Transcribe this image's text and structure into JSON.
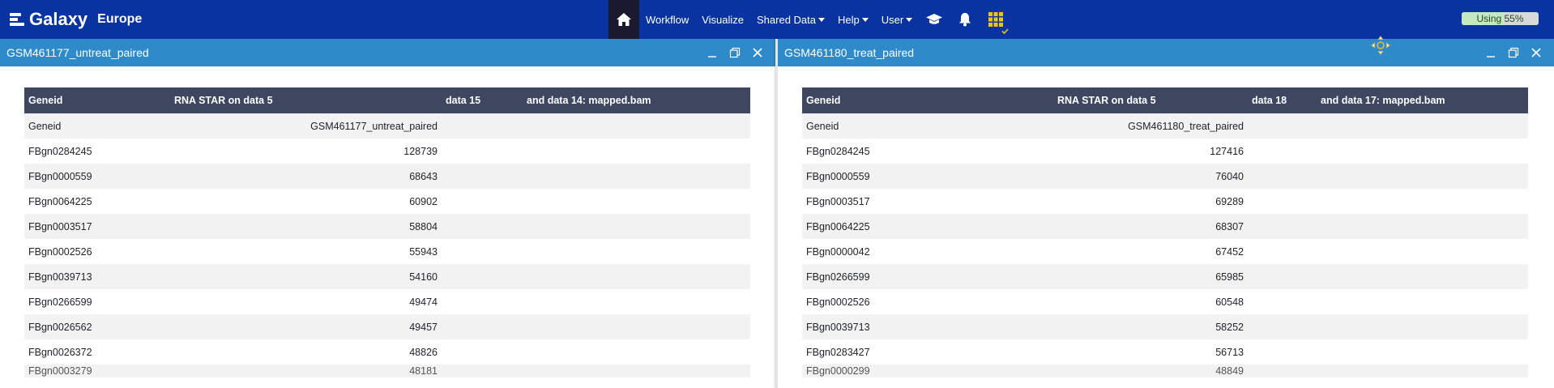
{
  "brand": {
    "name": "Galaxy",
    "subtitle": "Europe"
  },
  "nav": {
    "workflow": "Workflow",
    "visualize": "Visualize",
    "shared_data": "Shared Data",
    "help": "Help",
    "user": "User"
  },
  "quota": {
    "label": "Using 55%",
    "percent": 55
  },
  "left_window": {
    "title": "GSM461177_untreat_paired",
    "headers": [
      "Geneid",
      "RNA STAR on data 5",
      "data 15",
      "and data 14: mapped.bam"
    ],
    "rows": [
      [
        "Geneid",
        "GSM461177_untreat_paired"
      ],
      [
        "FBgn0284245",
        "128739"
      ],
      [
        "FBgn0000559",
        "68643"
      ],
      [
        "FBgn0064225",
        "60902"
      ],
      [
        "FBgn0003517",
        "58804"
      ],
      [
        "FBgn0002526",
        "55943"
      ],
      [
        "FBgn0039713",
        "54160"
      ],
      [
        "FBgn0266599",
        "49474"
      ],
      [
        "FBgn0026562",
        "49457"
      ],
      [
        "FBgn0026372",
        "48826"
      ],
      [
        "FBgn0003279",
        "48181"
      ]
    ]
  },
  "right_window": {
    "title": "GSM461180_treat_paired",
    "headers": [
      "Geneid",
      "RNA STAR on data 5",
      "data 18",
      "and data 17: mapped.bam"
    ],
    "rows": [
      [
        "Geneid",
        "GSM461180_treat_paired"
      ],
      [
        "FBgn0284245",
        "127416"
      ],
      [
        "FBgn0000559",
        "76040"
      ],
      [
        "FBgn0003517",
        "69289"
      ],
      [
        "FBgn0064225",
        "68307"
      ],
      [
        "FBgn0000042",
        "67452"
      ],
      [
        "FBgn0266599",
        "65985"
      ],
      [
        "FBgn0002526",
        "60548"
      ],
      [
        "FBgn0039713",
        "58252"
      ],
      [
        "FBgn0283427",
        "56713"
      ],
      [
        "FBgn0000299",
        "48849"
      ]
    ]
  },
  "icons": [
    "home-icon",
    "graduation-cap-icon",
    "bell-icon",
    "grid-icon",
    "minimize-icon",
    "maximize-icon",
    "close-icon",
    "move-icon"
  ],
  "colors": {
    "masthead": "#0833a0",
    "window_bar": "#2e8ac9",
    "table_header": "#3f4660",
    "grid_icon": "#f5c400"
  }
}
